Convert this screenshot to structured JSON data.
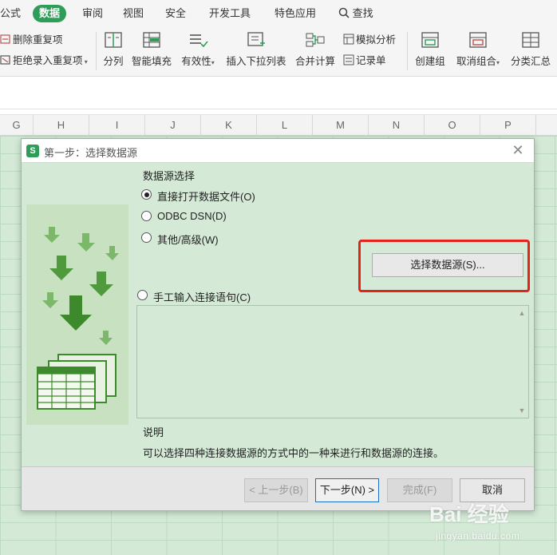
{
  "menu": {
    "tabs": [
      "公式",
      "数据",
      "审阅",
      "视图",
      "安全",
      "开发工具",
      "特色应用"
    ],
    "active": "数据",
    "search_label": "查找"
  },
  "ribbon": {
    "remove_duplicates": "删除重复项",
    "reject_duplicates": "拒绝录入重复项",
    "split_column": "分列",
    "smart_fill": "智能填充",
    "validity": "有效性",
    "insert_dropdown": "插入下拉列表",
    "consolidate": "合并计算",
    "what_if": "模拟分析",
    "record_form": "记录单",
    "group": "创建组",
    "ungroup": "取消组合",
    "subtotal": "分类汇总"
  },
  "columns": [
    "G",
    "H",
    "I",
    "J",
    "K",
    "L",
    "M",
    "N",
    "O",
    "P"
  ],
  "dialog": {
    "logo": "S",
    "title": "第一步：选择数据源",
    "close_glyph": "✕",
    "section_label": "数据源选择",
    "options": [
      {
        "label": "直接打开数据文件(O)",
        "checked": true
      },
      {
        "label": "ODBC DSN(D)",
        "checked": false
      },
      {
        "label": "其他/高级(W)",
        "checked": false
      }
    ],
    "select_source_button": "选择数据源(S)...",
    "manual_option": "手工输入连接语句(C)",
    "desc_heading": "说明",
    "desc_text": "可以选择四种连接数据源的方式中的一种来进行和数据源的连接。",
    "buttons": {
      "prev": "< 上一步(B)",
      "next": "下一步(N) >",
      "finish": "完成(F)",
      "cancel": "取消"
    }
  },
  "watermark": {
    "logo_text": "Bai 经验",
    "url": "jingyan.baidu.com"
  },
  "colors": {
    "accent": "#2e9d58",
    "dialog_bg": "#d4ead7",
    "highlight": "#e4231b"
  }
}
